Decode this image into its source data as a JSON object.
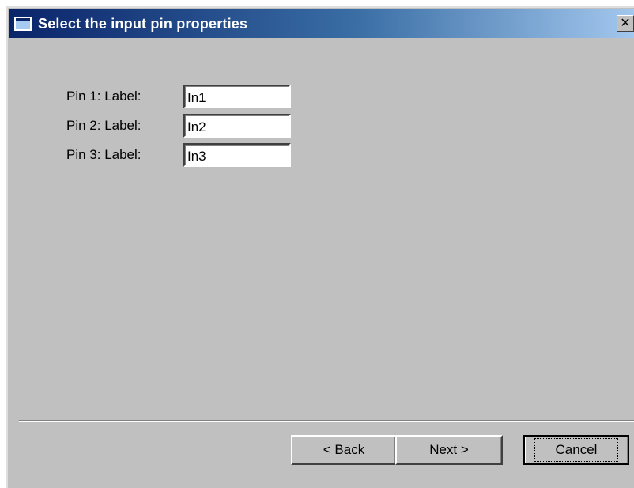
{
  "window": {
    "title": "Select the input pin properties",
    "close_symbol": "✕",
    "title_icon": "window-icon",
    "colors": {
      "titlebar_start": "#0a246a",
      "titlebar_end": "#a6caf0",
      "face": "#c0c0c0"
    }
  },
  "pins": [
    {
      "label": "Pin 1: Label:",
      "value": "In1"
    },
    {
      "label": "Pin 2: Label:",
      "value": "In2"
    },
    {
      "label": "Pin 3: Label:",
      "value": "In3"
    }
  ],
  "footer": {
    "back_label": "< Back",
    "next_label": "Next >",
    "cancel_label": "Cancel"
  }
}
